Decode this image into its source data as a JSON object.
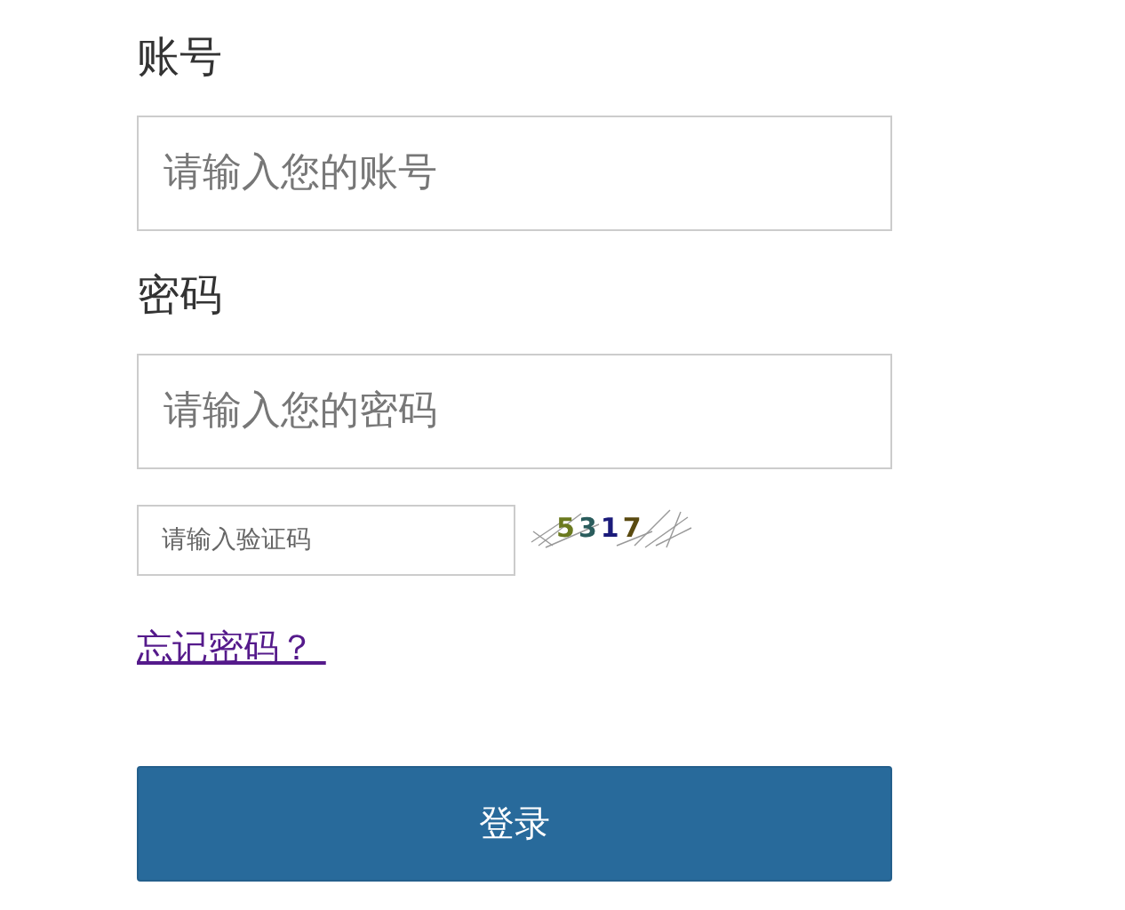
{
  "account": {
    "label": "账号",
    "placeholder": "请输入您的账号"
  },
  "password": {
    "label": "密码",
    "placeholder": "请输入您的密码"
  },
  "captcha": {
    "placeholder": "请输入验证码",
    "code": "5317"
  },
  "forgot_link": "忘记密码？ ",
  "submit": "登录"
}
